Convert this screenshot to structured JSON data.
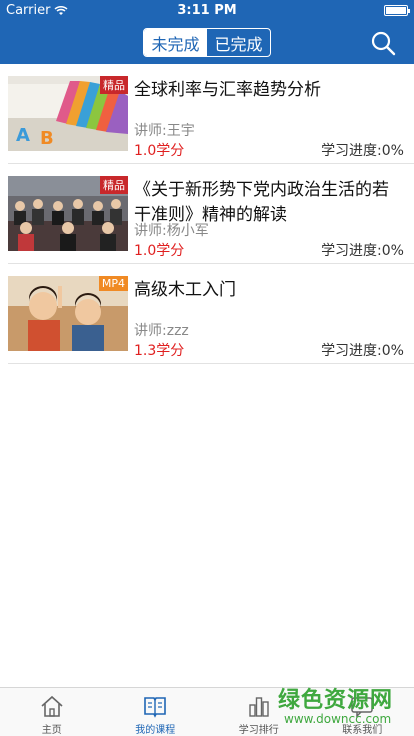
{
  "status": {
    "carrier": "Carrier",
    "time": "3:11 PM"
  },
  "header": {
    "segments": [
      {
        "label": "未完成",
        "active": true
      },
      {
        "label": "已完成",
        "active": false
      }
    ]
  },
  "courses": [
    {
      "title": "全球利率与汇率趋势分析",
      "teacher": "讲师:王宇",
      "credit": "1.0学分",
      "progress": "学习进度:0%",
      "badge": "精品"
    },
    {
      "title": "《关于新形势下党内政治生活的若干准则》精神的解读",
      "teacher": "讲师:杨小军",
      "credit": "1.0学分",
      "progress": "学习进度:0%",
      "badge": "精品"
    },
    {
      "title": "高级木工入门",
      "teacher": "讲师:zzz",
      "credit": "1.3学分",
      "progress": "学习进度:0%",
      "badge": "MP4"
    }
  ],
  "tabbar": [
    {
      "label": "主页",
      "icon": "home-icon"
    },
    {
      "label": "我的课程",
      "icon": "book-icon"
    },
    {
      "label": "学习排行",
      "icon": "ranking-icon"
    },
    {
      "label": "联系我们",
      "icon": "contact-icon"
    }
  ],
  "watermark": {
    "text": "绿色资源网",
    "url": "www.downcc.com"
  },
  "colors": {
    "primary": "#1f66b5",
    "credit": "#e02020",
    "badge_red": "#c8282b",
    "badge_orange": "#f08a24"
  }
}
